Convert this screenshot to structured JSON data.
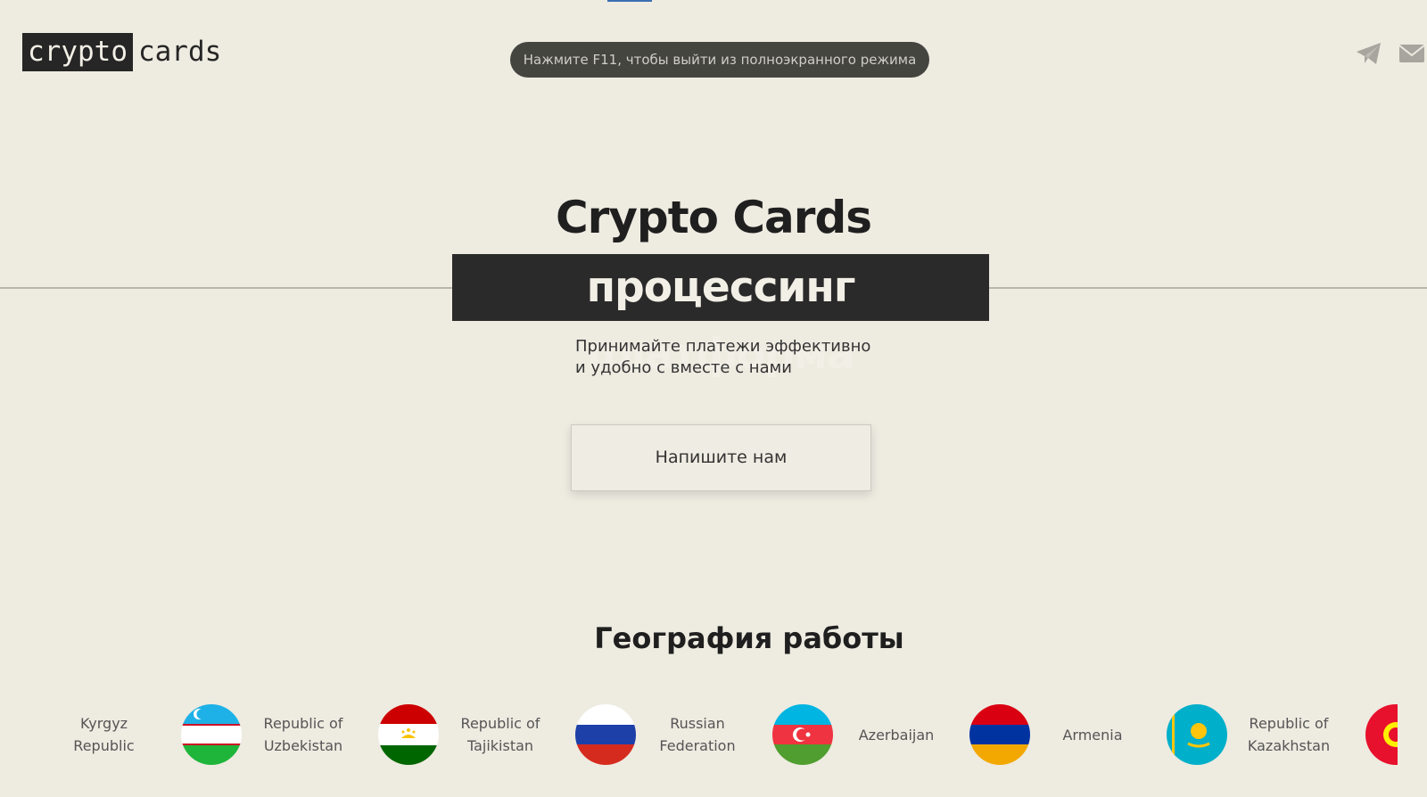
{
  "header": {
    "logo_dark": "crypto",
    "logo_light": "cards",
    "fullscreen_notice": "Нажмите F11, чтобы выйти из полноэкранного режима",
    "icons": [
      "telegram-icon",
      "mail-icon"
    ]
  },
  "hero": {
    "title": "Crypto Cards",
    "banner": "процессинг платформа",
    "subtitle_line1": "Принимайте платежи эффективно",
    "subtitle_line2": "и удобно с вместе с нами",
    "cta_label": "Напишите нам"
  },
  "geography": {
    "title": "География работы",
    "countries": [
      {
        "line1": "Kyrgyz Republic",
        "line2": ""
      },
      {
        "line1": "Republic of",
        "line2": "Uzbekistan"
      },
      {
        "line1": "Republic of",
        "line2": "Tajikistan"
      },
      {
        "line1": "Russian",
        "line2": "Federation"
      },
      {
        "line1": "Azerbaijan",
        "line2": ""
      },
      {
        "line1": "Armenia",
        "line2": ""
      },
      {
        "line1": "Republic of",
        "line2": "Kazakhstan"
      }
    ]
  },
  "colors": {
    "background": "#eeebe1",
    "dark": "#2a2a2a",
    "accent": "#3b6fb3"
  }
}
